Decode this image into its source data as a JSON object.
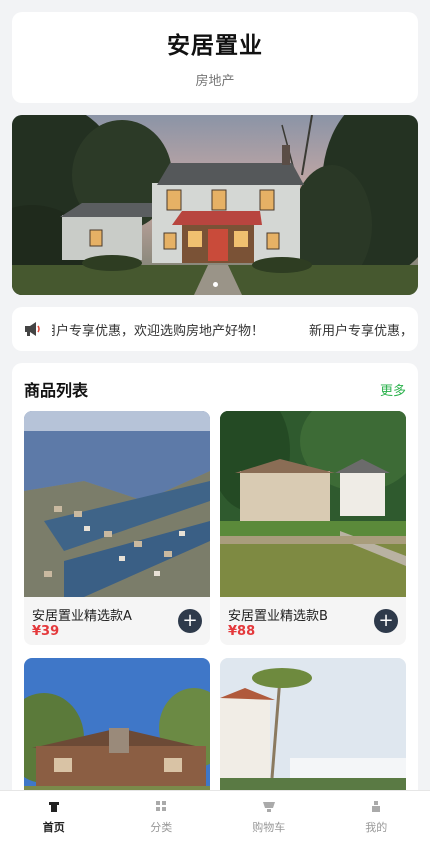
{
  "header": {
    "title": "安居置业",
    "subtitle": "房地产"
  },
  "banner": {
    "slide_count": 1,
    "active_slide": 1
  },
  "notice": {
    "icon": "megaphone-icon",
    "segments": [
      "新用户专享优惠，欢迎选购房地产好物！",
      "新用户专享优惠，"
    ]
  },
  "products": {
    "title": "商品列表",
    "more": "更多",
    "items": [
      {
        "name": "安居置业精选款A",
        "price": "¥39"
      },
      {
        "name": "安居置业精选款B",
        "price": "¥88"
      },
      {
        "name": "",
        "price": ""
      },
      {
        "name": "",
        "price": ""
      }
    ]
  },
  "tabbar": {
    "active": 0,
    "items": [
      {
        "label": "首页",
        "icon": "home-icon"
      },
      {
        "label": "分类",
        "icon": "grid-icon"
      },
      {
        "label": "购物车",
        "icon": "cart-icon"
      },
      {
        "label": "我的",
        "icon": "user-icon"
      }
    ]
  },
  "colors": {
    "accent": "#2bb24c",
    "price": "#e4393c",
    "button": "#2e3a4b"
  }
}
